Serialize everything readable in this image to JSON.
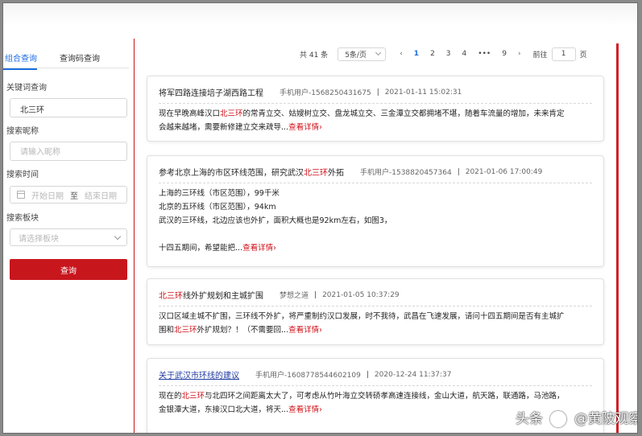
{
  "sidebar": {
    "tabs": [
      "组合查询",
      "查询码查询"
    ],
    "keyword_label": "关键词查询",
    "keyword_value": "北三环",
    "nickname_label": "搜索昵称",
    "nickname_placeholder": "请输入昵称",
    "time_label": "搜索时间",
    "date_start": "开始日期",
    "date_sep": "至",
    "date_end": "结束日期",
    "board_label": "搜索板块",
    "board_placeholder": "请选择板块",
    "submit_label": "查询"
  },
  "pagination": {
    "total": "共 41 条",
    "page_size": "5条/页",
    "prev": "‹",
    "pages": [
      "1",
      "2",
      "3",
      "4",
      "•••",
      "9"
    ],
    "next": "›",
    "goto_label": "前往",
    "goto_value": "1",
    "page_unit": "页"
  },
  "results": [
    {
      "title": "将军四路连接培子湖西路工程",
      "user": "手机用户-1568250431675",
      "time": "2021-01-11 15:02:31",
      "lines": [
        [
          "现在早晚高峰汉口",
          {
            "hl": "北三环"
          },
          "的常青立交、姑嫂树立交、盘龙城立交、三金潭立交都拥堵不堪，随着车流量的增加，未来肯定"
        ],
        [
          "会越来越堵，需要新修建立交来疏导...",
          {
            "more": "查看详情›"
          }
        ]
      ]
    },
    {
      "title_parts": [
        "参考北京上海的市区环线范围，研究武汉",
        {
          "hl": "北三环"
        },
        "外拓"
      ],
      "user": "手机用户-1538820457364",
      "time": "2021-01-06 17:00:49",
      "lines": [
        [
          "上海的三环线（市区范围），99千米"
        ],
        [
          "北京的五环线（市区范围），94km"
        ],
        [
          "武汉的三环线，北边应该也外扩，面积大概也是92km左右，如图3，"
        ],
        [
          ""
        ],
        [
          "十四五期间，希望能把...",
          {
            "more": "查看详情›"
          }
        ]
      ]
    },
    {
      "title_parts": [
        {
          "hl": "北三环"
        },
        "线外扩规划和主城扩围"
      ],
      "user": "梦想之道",
      "time": "2021-01-05 10:37:29",
      "lines": [
        [
          "汉口区域主城不扩围，三环线不外扩，将严重制约汉口发展，时不我待，武昌在飞速发展，请问十四五期间是否有主城扩"
        ],
        [
          "围和",
          {
            "hl": "北三环"
          },
          "外扩规划？！（不需要回...",
          {
            "more": "查看详情›"
          }
        ]
      ]
    },
    {
      "title": "关于武汉市环线的建议",
      "user": "手机用户-1608778544602109",
      "time": "2020-12-24 11:37:37",
      "lines": [
        [
          "现在的",
          {
            "hl": "北三环"
          },
          "与北四环之间距离太大了，可考虑从竹叶海立交转硚孝高速连接线，金山大道，航天路，联通路，马池路，"
        ],
        [
          "金银潭大道，东接汉口北大道，将天...",
          {
            "more": "查看详情›"
          }
        ]
      ]
    }
  ],
  "watermark": {
    "left": "头条",
    "right": "@黄陂观察"
  },
  "colors": {
    "accent_red": "#c8161d",
    "link_blue": "#1e6ee0"
  }
}
